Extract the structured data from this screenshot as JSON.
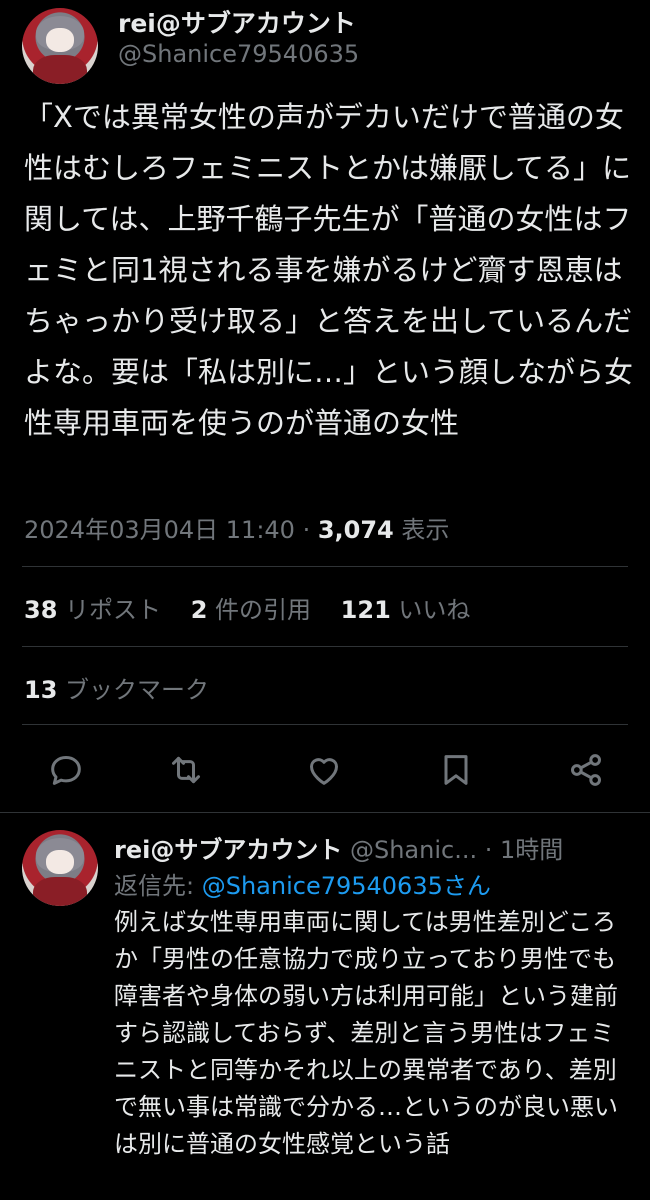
{
  "main_tweet": {
    "display_name": "rei@サブアカウント",
    "handle": "@Shanice79540635",
    "text": "「Xでは異常女性の声がデカいだけで普通の女性はむしろフェミニストとかは嫌厭してる」に関しては、上野千鶴子先生が「普通の女性はフェミと同1視される事を嫌がるけど齎す恩恵はちゃっかり受け取る」と答えを出しているんだよな。要は「私は別に…」という顔しながら女性専用車両を使うのが普通の女性",
    "timestamp": "2024年03月04日 11:40 · ",
    "views_count": "3,074",
    "views_label": " 表示",
    "stats": {
      "reposts_count": "38",
      "reposts_label": "リポスト",
      "quotes_count": "2",
      "quotes_label": "件の引用",
      "likes_count": "121",
      "likes_label": "いいね",
      "bookmarks_count": "13",
      "bookmarks_label": "ブックマーク"
    }
  },
  "actions": {
    "icons": [
      "reply-icon",
      "repost-icon",
      "like-icon",
      "bookmark-icon",
      "share-icon"
    ]
  },
  "reply_tweet": {
    "display_name": "rei@サブアカウント",
    "handle_time": " @Shanic... · 1時間",
    "reply_to_label": "返信先: ",
    "reply_to_mention": "@Shanice79540635さん",
    "text": "例えば女性専用車両に関しては男性差別どころか「男性の任意協力で成り立っており男性でも障害者や身体の弱い方は利用可能」という建前すら認識しておらず、差別と言う男性はフェミニストと同等かそれ以上の異常者であり、差別で無い事は常識で分かる…というのが良い悪いは別に普通の女性感覚という話"
  },
  "colors": {
    "background": "#000000",
    "text": "#e7e9ea",
    "muted": "#71767b",
    "link": "#1d9bf0",
    "divider": "#2f3336"
  }
}
